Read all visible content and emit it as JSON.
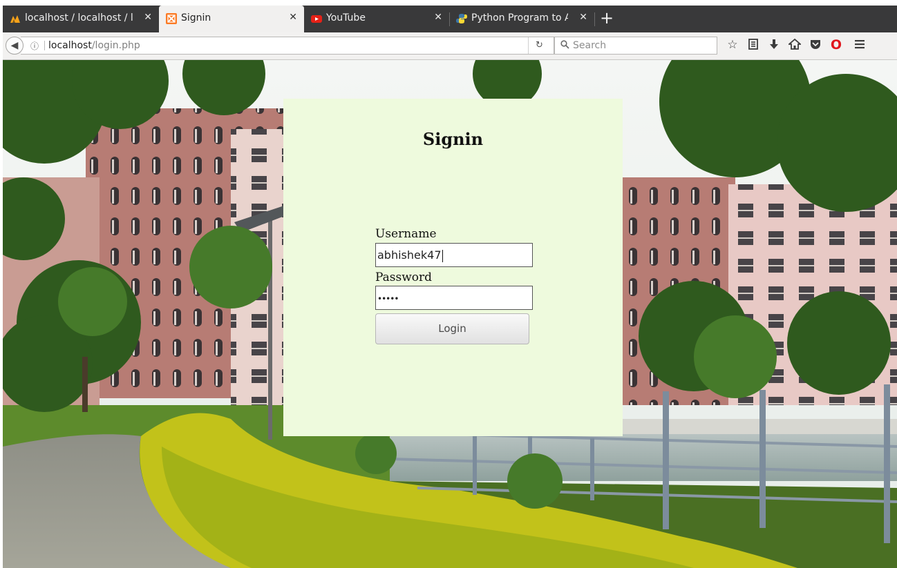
{
  "browser": {
    "tabs": [
      {
        "title": "localhost / localhost / l",
        "icon": "phpmyadmin-icon",
        "active": false
      },
      {
        "title": "Signin",
        "icon": "xampp-icon",
        "active": true
      },
      {
        "title": "YouTube",
        "icon": "youtube-icon",
        "active": false
      },
      {
        "title": "Python Program to Ad",
        "icon": "python-icon",
        "active": false
      }
    ],
    "new_tab_label": "+",
    "url_host": "localhost",
    "url_path": "/login.php",
    "search_placeholder": "Search",
    "toolbar_icons": [
      "bookmark-star-icon",
      "reading-list-icon",
      "downloads-icon",
      "home-icon",
      "pocket-icon",
      "opera-icon",
      "menu-icon"
    ]
  },
  "page": {
    "title": "Signin",
    "username_label": "Username",
    "username_value": "abhishek47",
    "password_label": "Password",
    "password_value": "•••••",
    "login_button": "Login"
  },
  "colors": {
    "panel_bg": "#eefadd",
    "tabstrip_bg": "#39393a",
    "youtube_red": "#e62117",
    "opera_red": "#e0171e"
  }
}
